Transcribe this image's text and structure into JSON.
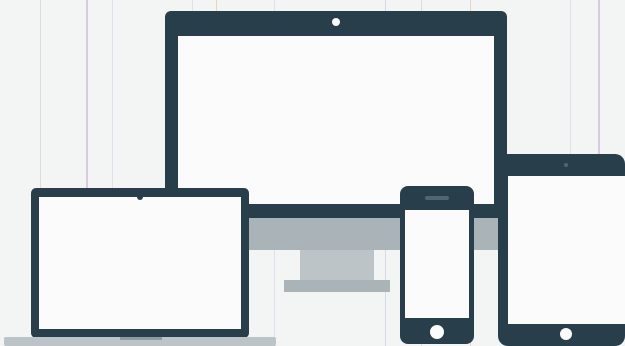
{
  "illustration": {
    "devices": [
      "desktop-monitor",
      "laptop",
      "smartphone",
      "tablet"
    ],
    "colors": {
      "background": "#f3f4f4",
      "device_body": "#283e4a",
      "screen": "#fbfbfb",
      "stand": "#aab3b8",
      "laptop_base": "#bcc4c8",
      "scan_lines": [
        "#c7a9d8",
        "#b9c6e6",
        "#e0b9a0",
        "#d9c3cf",
        "#c9d2e8"
      ]
    }
  }
}
